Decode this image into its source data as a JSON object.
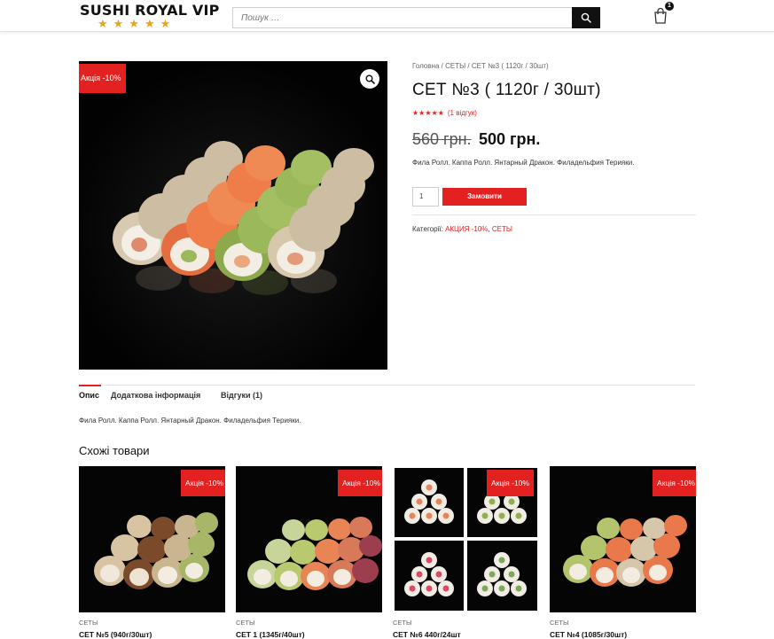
{
  "header": {
    "logo_text": "SUSHI ROYAL VIP",
    "logo_stars": "★★★★★",
    "search_placeholder": "Пошук …",
    "cart_count": "1"
  },
  "product": {
    "sale_badge": "Акція -10%",
    "breadcrumb": [
      "Головна",
      "СЕТЫ",
      "СЕТ №3 ( 1120г / 30шт)"
    ],
    "breadcrumb_sep": " / ",
    "title": "СЕТ №3 ( 1120г / 30шт)",
    "rating_stars": "★★★★★",
    "review_link": "(1 відгук)",
    "old_price": "560 грн.",
    "new_price": "500 грн.",
    "short_description": "Фила Ролл. Каппа Ролл. Янтарный Дракон. Филадельфия Терияки.",
    "quantity": "1",
    "order_button": "Замовити",
    "categories_label": "Категорії:",
    "categories": [
      "АКЦИЯ -10%",
      "СЕТЫ"
    ],
    "categories_sep": ", "
  },
  "tabs": {
    "items": [
      "Опис",
      "Додаткова інформація",
      "Відгуки (1)"
    ],
    "description": "Фила Ролл. Каппа Ролл. Янтарный Дракон. Филадельфия Терияки."
  },
  "related": {
    "title": "Схожі товари",
    "items": [
      {
        "badge": "Акція -10%",
        "category": "СЕТЫ",
        "name": "СЕТ №5 (940г/30шт)"
      },
      {
        "badge": "Акція -10%",
        "category": "СЕТЫ",
        "name": "СЕТ 1 (1345г/40шт)"
      },
      {
        "badge": "Акція -10%",
        "category": "СЕТЫ",
        "name": "СЕТ №6 440г/24шт"
      },
      {
        "badge": "Акція -10%",
        "category": "СЕТЫ",
        "name": "СЕТ №4 (1085г/30шт)"
      }
    ]
  },
  "colors": {
    "accent": "#e32121",
    "logo_stars": "#e7a51b",
    "search_button": "#111111",
    "image_background": "#060606"
  }
}
